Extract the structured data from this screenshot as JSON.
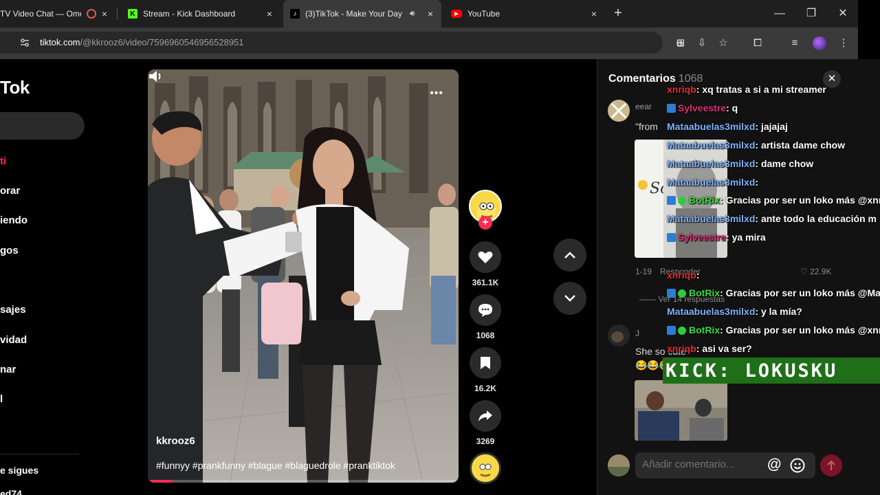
{
  "browser": {
    "tabs": [
      {
        "title": "TV Video Chat — Ome",
        "close": "×"
      },
      {
        "title": "Stream - Kick Dashboard",
        "close": "×"
      },
      {
        "title": "(3)TikTok - Make Your Day",
        "close": "×"
      },
      {
        "title": "YouTube",
        "close": "×"
      }
    ],
    "new_tab": "+",
    "url_host": "tiktok.com",
    "url_path": "/@kkrooz6/video/7596960546956528951",
    "window": {
      "minimize": "—",
      "restore": "❐",
      "close": "✕"
    }
  },
  "sidebar": {
    "logo": "Tok",
    "items": [
      {
        "label": "ti"
      },
      {
        "label": "orar"
      },
      {
        "label": "iendo"
      },
      {
        "label": "gos"
      },
      {
        "label": "sajes"
      },
      {
        "label": "vidad"
      },
      {
        "label": "nar"
      },
      {
        "label": "l"
      },
      {
        "label": "e sigues"
      },
      {
        "label": "ed74"
      }
    ]
  },
  "video": {
    "author": "kkrooz6",
    "caption": "#funnyy #prankfunny #blague #blaguedrole #pranktiktok",
    "more": "•••",
    "progress_fraction": 0.08,
    "likes": "361.1K",
    "comments": "1068",
    "saves": "16.2K",
    "shares": "3269"
  },
  "comments": {
    "title": "Comentarios",
    "count": "1068",
    "close": "✕",
    "entries": [
      {
        "user": "eear",
        "text": "\"from"
      },
      {
        "date": "1-19",
        "reply": "Responder",
        "likes": "22.9K",
        "view_replies": "Ver 14 respuestas"
      },
      {
        "user": "J",
        "text": "She so cute"
      }
    ],
    "input_placeholder": "Añadir comentario...",
    "at_symbol": "@"
  },
  "chat": {
    "lines": [
      {
        "user": "xnriqb",
        "user_color": "#e03030",
        "msg": ": xq tratas a si a mi streamer"
      },
      {
        "user": "Sylveestre",
        "user_color": "#e0307a",
        "msg": ": q"
      },
      {
        "user": "Mataabuelas3milxd",
        "user_color": "#7fb4ff",
        "msg": ": jajajaj"
      },
      {
        "user": "Mataabuelas3milxd",
        "user_color": "#7fb4ff",
        "msg": ": artista dame chow"
      },
      {
        "user": "Mataabuelas3milxd",
        "user_color": "#7fb4ff",
        "msg": ": dame chow"
      },
      {
        "user": "Mataabuelas3milxd",
        "user_color": "#7fb4ff",
        "msg": ":"
      },
      {
        "user": "BotRix",
        "user_color": "#3ddc3d",
        "msg": ": Gracias por ser un loko más @xnri"
      },
      {
        "user": "Mataabuelas3milxd",
        "user_color": "#7fb4ff",
        "msg": ": ante todo la educación m"
      },
      {
        "user": "Sylveestre",
        "user_color": "#e0307a",
        "msg": ": ya mira"
      },
      {
        "user": "xnriqb",
        "user_color": "#e03030",
        "msg": ":"
      },
      {
        "user": "BotRix",
        "user_color": "#3ddc3d",
        "msg": ": Gracias por ser un loko más @Mat"
      },
      {
        "user": "Mataabuelas3milxd",
        "user_color": "#7fb4ff",
        "msg": ": y la mía?"
      },
      {
        "user": "BotRix",
        "user_color": "#3ddc3d",
        "msg": ": Gracias por ser un loko más @xnri"
      },
      {
        "user": "xnriqb",
        "user_color": "#e03030",
        "msg": ": asi va ser?"
      }
    ],
    "kick_banner": "KICK: LOKUSKU"
  },
  "colors": {
    "accent": "#fe2c55",
    "kick_green": "#1f6f18"
  }
}
